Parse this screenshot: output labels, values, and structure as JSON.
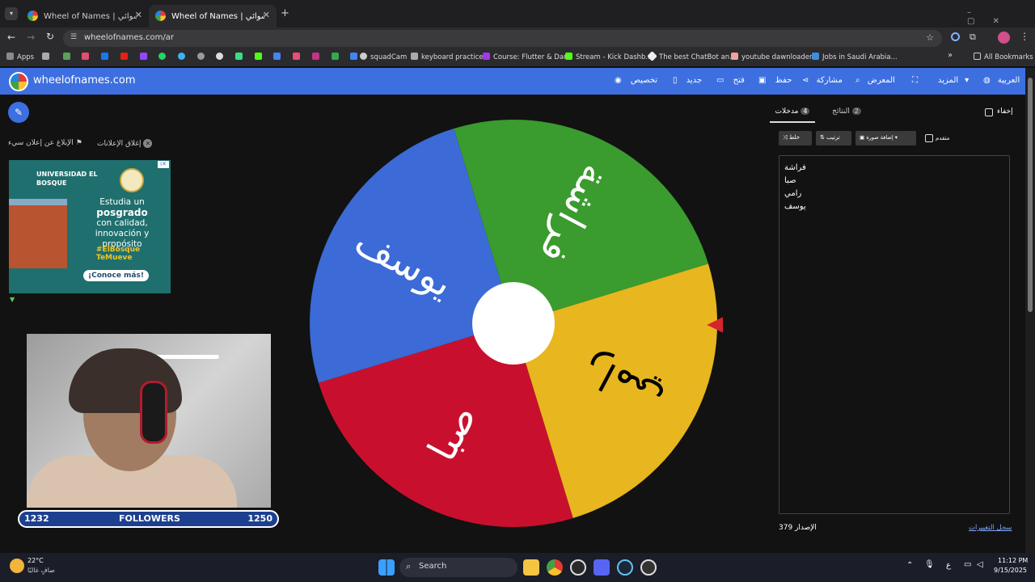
{
  "browser": {
    "tabs": [
      {
        "label": "Wheel of Names | عجلة الاسم العشوائي"
      },
      {
        "label": "Wheel of Names | عجلة الاسم العشوائي"
      }
    ],
    "new_tab": "+",
    "url": "wheelofnames.com/ar",
    "bookmarks": [
      {
        "label": "Apps"
      },
      {
        "label": "squadCam"
      },
      {
        "label": "keyboard practice"
      },
      {
        "label": "Course: Flutter & Dart"
      },
      {
        "label": "Stream - Kick Dashb..."
      },
      {
        "label": "The best ChatBot an..."
      },
      {
        "label": "youtube dawnloader"
      },
      {
        "label": "Jobs in Saudi Arabia..."
      },
      {
        "label": "All Bookmarks"
      }
    ]
  },
  "app": {
    "logo": "wheelofnames.com",
    "nav": {
      "customize": "تخصيص",
      "new": "جديد",
      "open": "فتح",
      "save": "حفظ",
      "share": "مشاركة",
      "gallery": "المعرض",
      "more": "المزيد",
      "language": "العربية"
    }
  },
  "ads": {
    "report": "الإبلاغ عن إعلان سيء",
    "close": "إغلاق الإعلانات",
    "university": "UNIVERSIDAD EL BOSQUE",
    "text": [
      "Estudia un",
      "posgrado",
      "con calidad,",
      "innovación y",
      "propósito"
    ],
    "hashtag": "#ElBosque TeMueve",
    "cta": "¡Conoce más!"
  },
  "wheel": {
    "segments": [
      {
        "label": "فراشة",
        "color": "#3a9b2e"
      },
      {
        "label": "رامي",
        "color": "#e8b61e"
      },
      {
        "label": "صبا",
        "color": "#c8102e"
      },
      {
        "label": "يوسف",
        "color": "#3c6ad6"
      }
    ],
    "pointer_color": "#d8242f"
  },
  "panel": {
    "hide": "إخفاء",
    "tab_entries": {
      "label": "مدخلات",
      "count": "4"
    },
    "tab_results": {
      "label": "النتائج",
      "count": "2"
    },
    "shuffle": "خلط",
    "sort": "ترتيب",
    "add_image": "إضافة صورة",
    "advanced": "متقدم",
    "entries": [
      "فراشة",
      "صبا",
      "رامي",
      "يوسف"
    ],
    "version_label": "الإصدار",
    "version": "379",
    "changelog": "سجل التغييرات"
  },
  "stream": {
    "followers_label": "FOLLOWERS",
    "current": "1232",
    "goal": "1250",
    "progress": 0.0
  },
  "taskbar": {
    "weather_temp": "22°C",
    "weather_desc": "صافٍ غالبًا",
    "search": "Search",
    "lang": "ع",
    "time": "11:12 PM",
    "date": "9/15/2025"
  }
}
